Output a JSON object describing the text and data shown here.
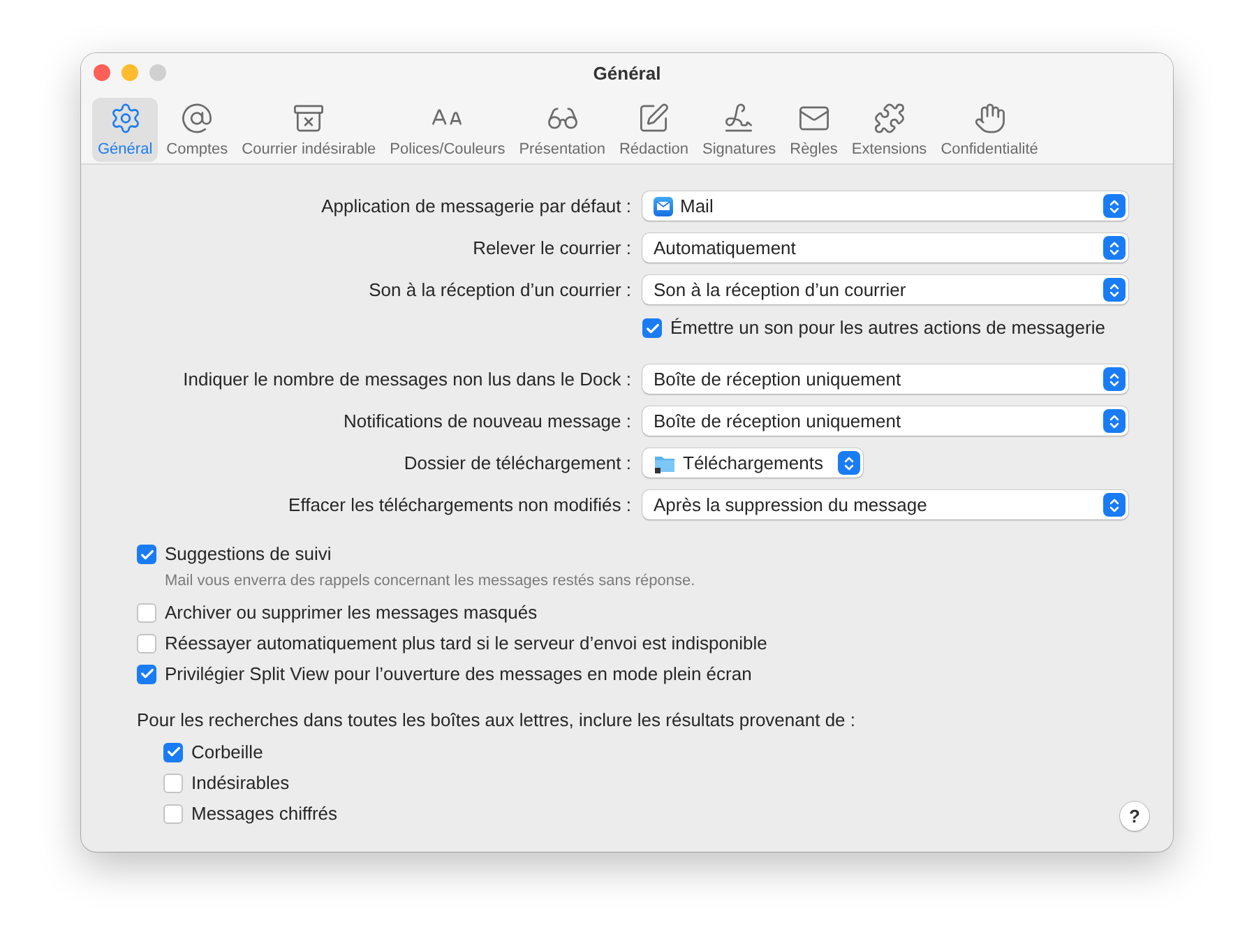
{
  "window": {
    "title": "Général"
  },
  "toolbar": [
    {
      "label": "Général",
      "selected": true,
      "kind": "gear"
    },
    {
      "label": "Comptes",
      "selected": false,
      "kind": "at"
    },
    {
      "label": "Courrier indésirable",
      "selected": false,
      "kind": "junk"
    },
    {
      "label": "Polices/Couleurs",
      "selected": false,
      "kind": "fonts"
    },
    {
      "label": "Présentation",
      "selected": false,
      "kind": "glasses"
    },
    {
      "label": "Rédaction",
      "selected": false,
      "kind": "compose"
    },
    {
      "label": "Signatures",
      "selected": false,
      "kind": "signature"
    },
    {
      "label": "Règles",
      "selected": false,
      "kind": "rules"
    },
    {
      "label": "Extensions",
      "selected": false,
      "kind": "puzzle"
    },
    {
      "label": "Confidentialité",
      "selected": false,
      "kind": "hand"
    }
  ],
  "form_groups": [
    [
      {
        "kind": "app_popup",
        "label": "Application de messagerie par défaut :",
        "value": "Mail"
      },
      {
        "kind": "popup",
        "label": "Relever le courrier :",
        "value": "Automatiquement"
      },
      {
        "kind": "popup",
        "label": "Son à la réception d’un courrier :",
        "value": "Son à la réception d’un courrier"
      },
      {
        "kind": "checkbox",
        "label": "Émettre un son pour les autres actions de messagerie",
        "checked": true
      }
    ],
    [
      {
        "kind": "popup",
        "label": "Indiquer le nombre de messages non lus dans le Dock :",
        "value": "Boîte de réception uniquement"
      },
      {
        "kind": "popup",
        "label": "Notifications de nouveau message :",
        "value": "Boîte de réception uniquement"
      },
      {
        "kind": "folder",
        "label": "Dossier de téléchargement :",
        "value": "Téléchargements"
      },
      {
        "kind": "popup",
        "label": "Effacer les téléchargements non modifiés :",
        "value": "Après la suppression du message"
      }
    ]
  ],
  "options": [
    {
      "label": "Suggestions de suivi",
      "checked": true,
      "description": "Mail vous enverra des rappels concernant les messages restés sans réponse."
    },
    {
      "label": "Archiver ou supprimer les messages masqués",
      "checked": false
    },
    {
      "label": "Réessayer automatiquement plus tard si le serveur d’envoi est indisponible",
      "checked": false
    },
    {
      "label": "Privilégier Split View pour l’ouverture des messages en mode plein écran",
      "checked": true
    }
  ],
  "search_section": {
    "heading": "Pour les recherches dans toutes les boîtes aux lettres, inclure les résultats provenant de :",
    "items": [
      {
        "label": "Corbeille",
        "checked": true
      },
      {
        "label": "Indésirables",
        "checked": false
      },
      {
        "label": "Messages chiffrés",
        "checked": false
      }
    ]
  },
  "help_button": "?"
}
